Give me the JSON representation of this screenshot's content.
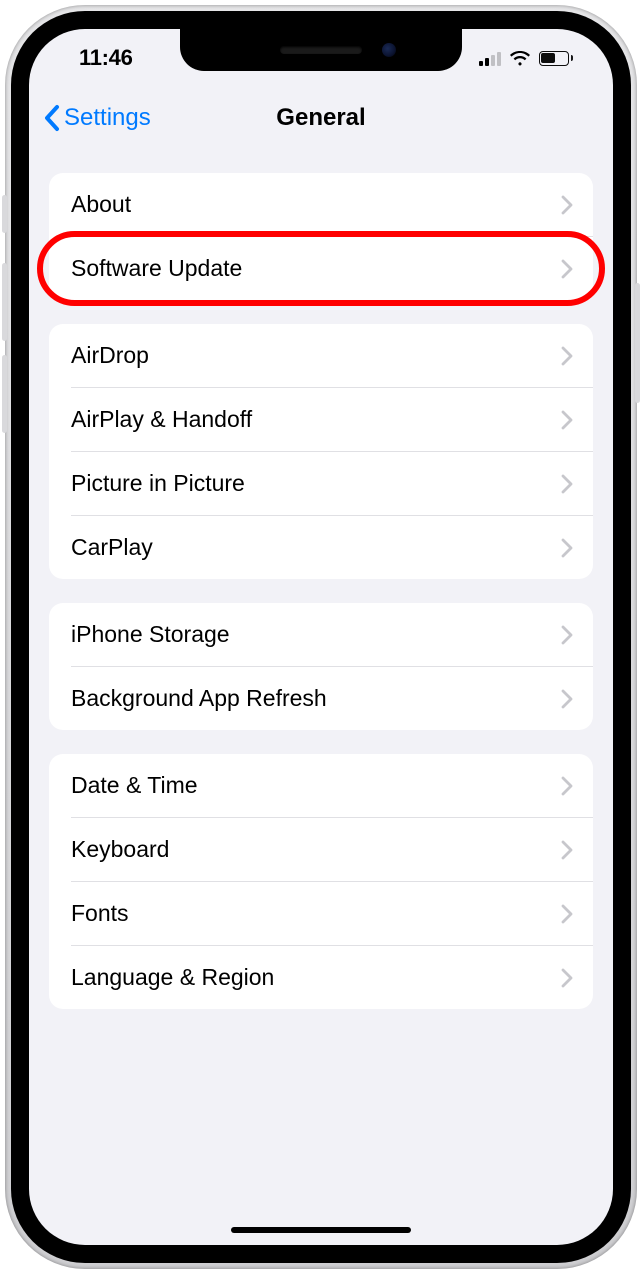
{
  "status": {
    "time": "11:46",
    "cell_active_bars": 2,
    "battery_percent": 62
  },
  "nav": {
    "back_label": "Settings",
    "title": "General"
  },
  "sections": [
    {
      "items": [
        {
          "name": "about",
          "label": "About",
          "highlight": false
        },
        {
          "name": "software-update",
          "label": "Software Update",
          "highlight": true
        }
      ]
    },
    {
      "items": [
        {
          "name": "airdrop",
          "label": "AirDrop",
          "highlight": false
        },
        {
          "name": "airplay-handoff",
          "label": "AirPlay & Handoff",
          "highlight": false
        },
        {
          "name": "picture-in-picture",
          "label": "Picture in Picture",
          "highlight": false
        },
        {
          "name": "carplay",
          "label": "CarPlay",
          "highlight": false
        }
      ]
    },
    {
      "items": [
        {
          "name": "iphone-storage",
          "label": "iPhone Storage",
          "highlight": false
        },
        {
          "name": "background-app-refresh",
          "label": "Background App Refresh",
          "highlight": false
        }
      ]
    },
    {
      "items": [
        {
          "name": "date-time",
          "label": "Date & Time",
          "highlight": false
        },
        {
          "name": "keyboard",
          "label": "Keyboard",
          "highlight": false
        },
        {
          "name": "fonts",
          "label": "Fonts",
          "highlight": false
        },
        {
          "name": "language-region",
          "label": "Language & Region",
          "highlight": false
        }
      ]
    }
  ]
}
